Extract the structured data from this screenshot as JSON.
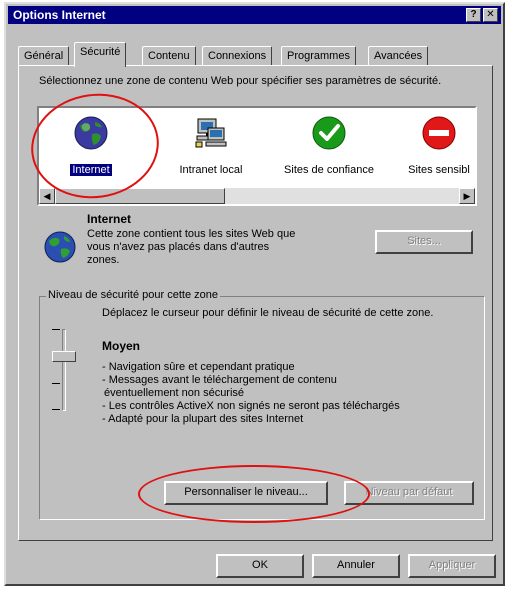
{
  "window": {
    "title": "Options Internet",
    "help_glyph": "?",
    "close_glyph": "✕"
  },
  "tabs": [
    {
      "label": "Général"
    },
    {
      "label": "Sécurité"
    },
    {
      "label": "Contenu"
    },
    {
      "label": "Connexions"
    },
    {
      "label": "Programmes"
    },
    {
      "label": "Avancées"
    }
  ],
  "active_tab": "Sécurité",
  "instructions": "Sélectionnez une zone de contenu Web pour spécifier ses paramètres de sécurité.",
  "zones": [
    {
      "label": "Internet",
      "icon": "globe-icon",
      "selected": true
    },
    {
      "label": "Intranet local",
      "icon": "local-intranet-icon"
    },
    {
      "label": "Sites de confiance",
      "icon": "trusted-sites-icon"
    },
    {
      "label": "Sites sensibl",
      "icon": "restricted-sites-icon"
    }
  ],
  "zone_info": {
    "title": "Internet",
    "description": "Cette zone contient tous les sites Web que vous n'avez pas placés dans d'autres zones.",
    "sites_button": "Sites..."
  },
  "security_level": {
    "group_label": "Niveau de sécurité pour cette zone",
    "instruction": "Déplacez le curseur pour définir le niveau de sécurité de cette zone.",
    "level_name": "Moyen",
    "bullets": [
      "- Navigation sûre et cependant pratique",
      "- Messages avant le téléchargement de contenu",
      "  éventuellement non sécurisé",
      "- Les contrôles ActiveX non signés ne seront pas téléchargés",
      "- Adapté pour la plupart des sites Internet"
    ],
    "custom_button": "Personnaliser le niveau...",
    "default_button": "Niveau par défaut"
  },
  "footer": {
    "ok": "OK",
    "cancel": "Annuler",
    "apply": "Appliquer"
  },
  "colors": {
    "highlight_circle": "#e01010",
    "title_bar": "#000080",
    "face": "#c0c0c0"
  }
}
